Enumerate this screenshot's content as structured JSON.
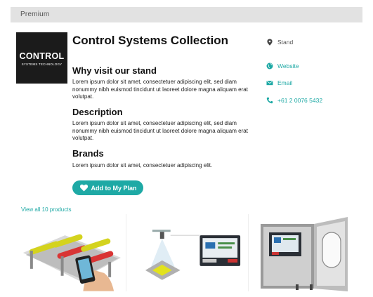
{
  "tier": {
    "label": "Premium"
  },
  "exhibitor": {
    "logo_text": "CONTROL",
    "logo_subtext": "SYSTEMS TECHNOLOGY",
    "name": "Control Systems Collection"
  },
  "sections": {
    "why_visit": {
      "heading": "Why visit our stand",
      "body": "Lorem ipsum dolor sit amet, consectetuer adipiscing elit, sed diam nonummy nibh euismod tincidunt ut laoreet dolore magna aliquam erat volutpat."
    },
    "description": {
      "heading": "Description",
      "body": "Lorem ipsum dolor sit amet, consectetuer adipiscing elit, sed diam nonummy nibh euismod tincidunt ut laoreet dolore magna aliquam erat volutpat."
    },
    "brands": {
      "heading": "Brands",
      "body": "Lorem ipsum dolor sit amet, consectetuer adipiscing elit."
    }
  },
  "actions": {
    "add_to_plan": "Add to My Plan"
  },
  "contact": {
    "stand_label": "Stand",
    "website_label": "Website",
    "email_label": "Email",
    "phone": "+61 2 0076 5432"
  },
  "products": {
    "view_all": "View all 10 products",
    "items": [
      {
        "icon": "conveyor-rollers-image"
      },
      {
        "icon": "sensor-diagram-image"
      },
      {
        "icon": "control-cabinet-image"
      }
    ]
  },
  "colors": {
    "accent": "#1ea9a5",
    "tier_bar": "#e2e2e2",
    "logo_bg": "#1b1b1b"
  }
}
